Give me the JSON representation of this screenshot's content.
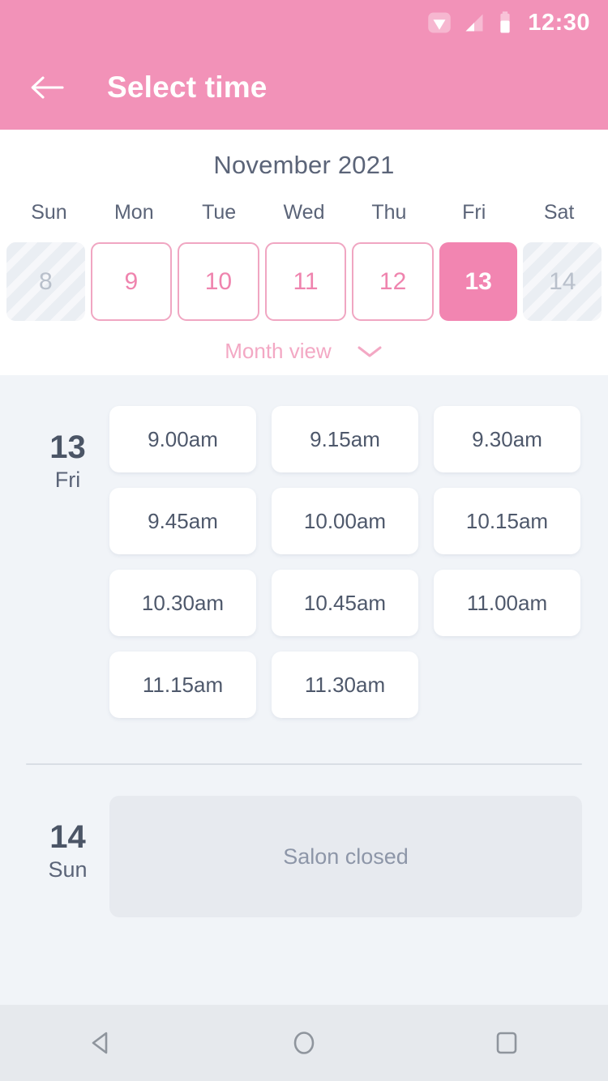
{
  "statusbar": {
    "time": "12:30",
    "icons": [
      "wifi-icon",
      "signal-icon",
      "battery-icon"
    ]
  },
  "appbar": {
    "back_icon": "back-arrow-icon",
    "title": "Select time"
  },
  "calendar": {
    "month_title": "November 2021",
    "weekdays": [
      "Sun",
      "Mon",
      "Tue",
      "Wed",
      "Thu",
      "Fri",
      "Sat"
    ],
    "days": [
      {
        "number": "8",
        "state": "disabled"
      },
      {
        "number": "9",
        "state": "available"
      },
      {
        "number": "10",
        "state": "available"
      },
      {
        "number": "11",
        "state": "available"
      },
      {
        "number": "12",
        "state": "available"
      },
      {
        "number": "13",
        "state": "selected"
      },
      {
        "number": "14",
        "state": "disabled"
      }
    ],
    "month_view_label": "Month view",
    "month_view_icon": "chevron-down-icon"
  },
  "schedule": [
    {
      "day_number": "13",
      "day_name": "Fri",
      "slots": [
        "9.00am",
        "9.15am",
        "9.30am",
        "9.45am",
        "10.00am",
        "10.15am",
        "10.30am",
        "10.45am",
        "11.00am",
        "11.15am",
        "11.30am"
      ],
      "closed_message": ""
    },
    {
      "day_number": "14",
      "day_name": "Sun",
      "slots": [],
      "closed_message": "Salon closed"
    }
  ],
  "navbar": {
    "back_label": "back-nav-icon",
    "home_label": "home-nav-icon",
    "recents_label": "recents-nav-icon"
  },
  "colors": {
    "brand_pink": "#f292b8",
    "selected_pink": "#f285b1",
    "border_pink": "#f0a6c2",
    "body_bg": "#f1f4f8",
    "slate": "#5b6478",
    "closed_bg": "#e7eaef"
  }
}
